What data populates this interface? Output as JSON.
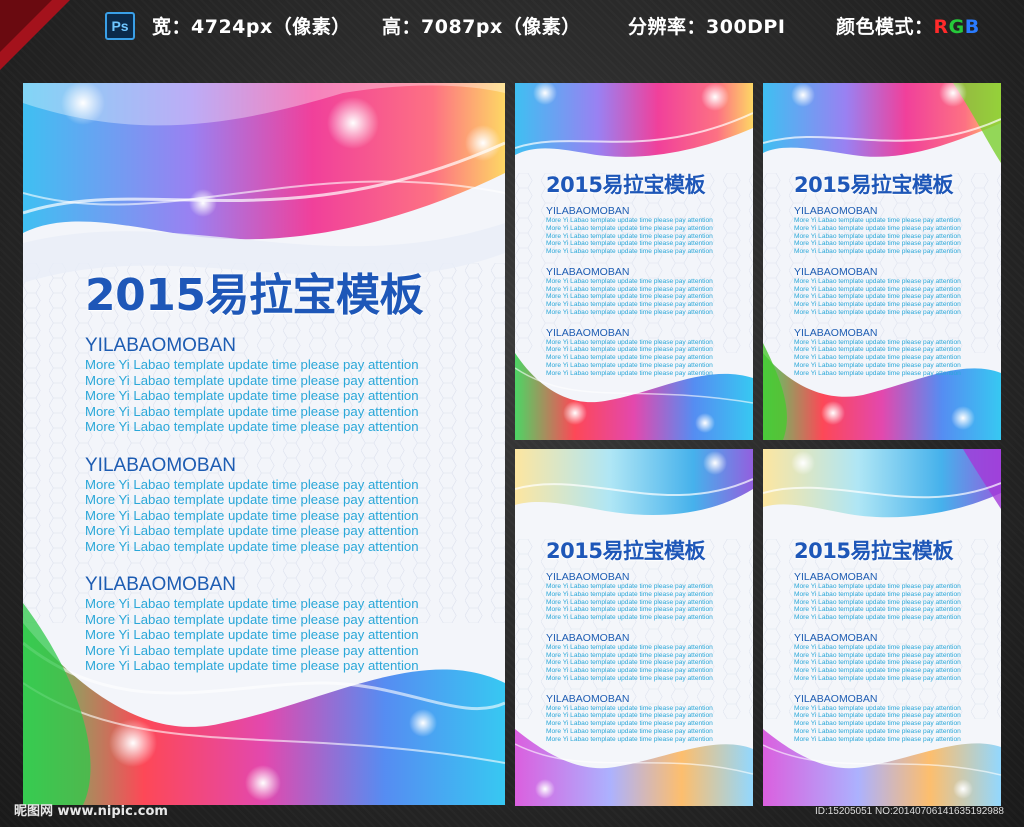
{
  "header": {
    "app_icon": "photoshop-icon",
    "app_icon_label": "Ps",
    "width_text": "宽：4724px（像素）",
    "height_text": "高：7087px（像素）",
    "resolution_text": "分辨率：300DPI",
    "color_mode_label": "颜色模式：",
    "color_mode_r": "R",
    "color_mode_g": "G",
    "color_mode_b": "B"
  },
  "poster": {
    "title": "2015易拉宝模板",
    "sections": [
      {
        "heading": "YILABAOMOBAN",
        "lines": [
          "More Yi Labao template update time please pay attention",
          "More Yi Labao template update time please pay attention",
          "More Yi Labao template update time please pay attention",
          "More Yi Labao template update time please pay attention",
          "More Yi Labao template update time please pay attention"
        ]
      },
      {
        "heading": "YILABAOMOBAN",
        "lines": [
          "More Yi Labao template update time please pay attention",
          "More Yi Labao template update time please pay attention",
          "More Yi Labao template update time please pay attention",
          "More Yi Labao template update time please pay attention",
          "More Yi Labao template update time please pay attention"
        ]
      },
      {
        "heading": "YILABAOMOBAN",
        "lines": [
          "More Yi Labao template update time please pay attention",
          "More Yi Labao template update time please pay attention",
          "More Yi Labao template update time please pay attention",
          "More Yi Labao template update time please pay attention",
          "More Yi Labao template update time please pay attention"
        ]
      }
    ]
  },
  "footer": {
    "watermark": "昵图网 www.nipic.com",
    "id_text": "ID:15205051 NO:20140706141635192988"
  },
  "colors": {
    "title_blue": "#1e57b8",
    "text_cyan": "#2aa7d8",
    "accent_red": "#a4121c"
  }
}
